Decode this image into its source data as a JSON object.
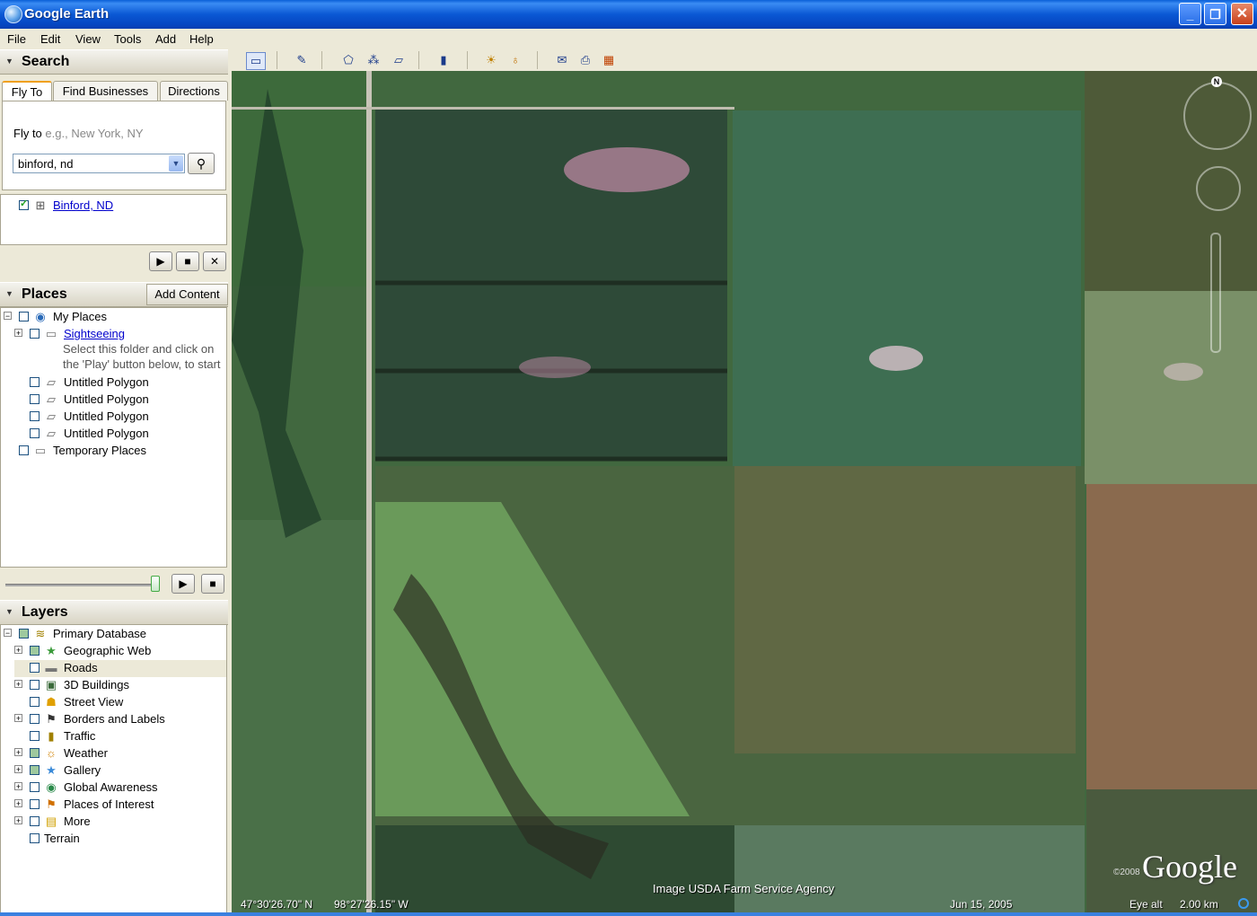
{
  "window": {
    "title": "Google Earth"
  },
  "menu": [
    "File",
    "Edit",
    "View",
    "Tools",
    "Add",
    "Help"
  ],
  "toolbar": {
    "icons": [
      "sidebar-icon",
      "placemark-icon",
      "polygon-icon",
      "path-icon",
      "overlay-icon",
      "ruler-icon",
      "sun-icon",
      "planet-icon",
      "email-icon",
      "print-icon",
      "maps-icon"
    ]
  },
  "search": {
    "header": "Search",
    "tabs": [
      "Fly To",
      "Find Businesses",
      "Directions"
    ],
    "flyto_label": "Fly to",
    "flyto_placeholder": "e.g., New York, NY",
    "query": "binford, nd",
    "results": [
      {
        "label": "Binford, ND",
        "checked": true
      }
    ]
  },
  "places": {
    "header": "Places",
    "add_content": "Add Content",
    "items": [
      {
        "label": "My Places"
      },
      {
        "label": "Sightseeing"
      },
      {
        "label": "Untitled Polygon"
      },
      {
        "label": "Untitled Polygon"
      },
      {
        "label": "Untitled Polygon"
      },
      {
        "label": "Untitled Polygon"
      },
      {
        "label": "Temporary Places"
      }
    ],
    "note_line1": "Select this folder and click on",
    "note_line2": "the 'Play' button below, to start"
  },
  "layers": {
    "header": "Layers",
    "items": [
      {
        "label": "Primary Database"
      },
      {
        "label": "Geographic Web"
      },
      {
        "label": "Roads"
      },
      {
        "label": "3D Buildings"
      },
      {
        "label": "Street View"
      },
      {
        "label": "Borders and Labels"
      },
      {
        "label": "Traffic"
      },
      {
        "label": "Weather"
      },
      {
        "label": "Gallery"
      },
      {
        "label": "Global Awareness"
      },
      {
        "label": "Places of Interest"
      },
      {
        "label": "More"
      },
      {
        "label": "Terrain"
      }
    ]
  },
  "map": {
    "credit": "Image USDA Farm Service Agency",
    "copyright": "©2008",
    "logo": "Google",
    "compass_label": "N",
    "status": {
      "lat": "47°30'26.70\" N",
      "lon": "98°27'26.15\" W",
      "date": "Jun 15, 2005",
      "eye_alt_label": "Eye alt",
      "eye_alt_value": "2.00 km"
    }
  },
  "colors": {
    "titlebar": "#0a58d4",
    "link": "#0000cc",
    "map_green": "#3f6a45"
  }
}
